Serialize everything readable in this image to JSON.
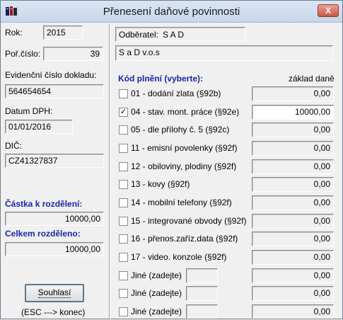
{
  "window": {
    "title": "Přenesení daňové povinnosti",
    "close": "X"
  },
  "left": {
    "rok_label": "Rok:",
    "rok_value": "2015",
    "por_label": "Poř.číslo:",
    "por_value": "39",
    "evid_label": "Evidenční číslo dokladu:",
    "evid_value": "564654654",
    "datum_label": "Datum DPH:",
    "datum_value": "01/01/2016",
    "dic_label": "DIČ:",
    "dic_value": "CZ41327837",
    "castka_label": "Částka k rozdělení:",
    "castka_value": "10000,00",
    "celkem_label": "Celkem rozděleno:",
    "celkem_value": "10000,00",
    "button_label": "Souhlasí",
    "esc_hint": "(ESC ---> konec)"
  },
  "right": {
    "odberatel_label": "Odběratel:",
    "odberatel_value": "S A D",
    "odberatel_name": "S a D v.o.s",
    "kod_label": "Kód plnění (vyberte):",
    "zaklad_label": "základ daně",
    "rows": [
      {
        "label": "01 - dodání zlata (§92b)",
        "checked": "",
        "value": "0,00"
      },
      {
        "label": "04 - stav. mont. práce (§92e)",
        "checked": "✓",
        "value": "10000,00"
      },
      {
        "label": "05 - dle přílohy č. 5 (§92c)",
        "checked": "",
        "value": "0,00"
      },
      {
        "label": "11 - emisní povolenky (§92f)",
        "checked": "",
        "value": "0,00"
      },
      {
        "label": "12 - obiloviny, plodiny (§92f)",
        "checked": "",
        "value": "0,00"
      },
      {
        "label": "13 - kovy (§92f)",
        "checked": "",
        "value": "0,00"
      },
      {
        "label": "14 - mobilní telefony (§92f)",
        "checked": "",
        "value": "0,00"
      },
      {
        "label": "15 - integrované obvody (§92f)",
        "checked": "",
        "value": "0,00"
      },
      {
        "label": "16 - přenos.zaříz.data (§92f)",
        "checked": "",
        "value": "0,00"
      },
      {
        "label": "17 - video. konzole (§92f)",
        "checked": "",
        "value": "0,00"
      },
      {
        "label": "Jiné (zadejte)",
        "checked": "",
        "value": "0,00"
      },
      {
        "label": "Jiné (zadejte)",
        "checked": "",
        "value": "0,00"
      },
      {
        "label": "Jiné (zadejte)",
        "checked": "",
        "value": "0,00"
      }
    ]
  }
}
